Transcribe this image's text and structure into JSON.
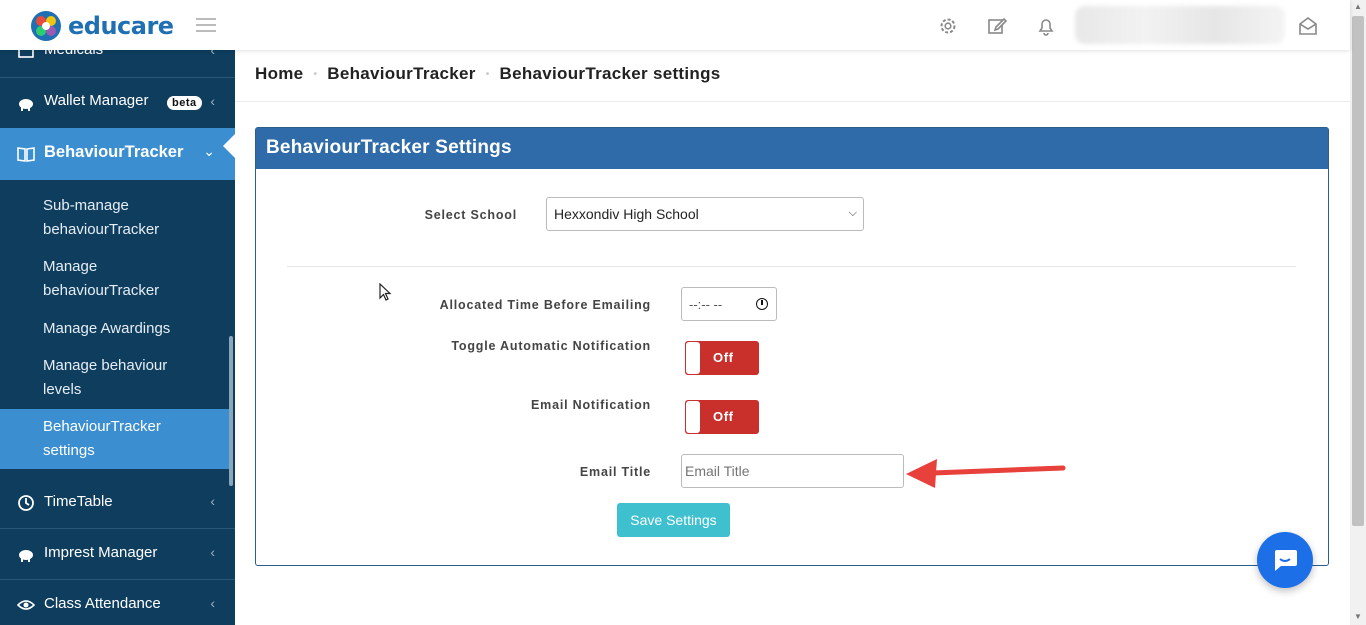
{
  "app": {
    "logo_text": "educare"
  },
  "breadcrumb": {
    "items": [
      "Home",
      "BehaviourTracker",
      "BehaviourTracker settings"
    ],
    "separator": "•"
  },
  "sidebar": {
    "items": [
      {
        "label": "Medicals",
        "icon": "medical-icon"
      },
      {
        "label": "Wallet Manager",
        "badge": "beta",
        "icon": "piggy-bank-icon"
      },
      {
        "label": "BehaviourTracker",
        "icon": "book-icon",
        "active": true
      },
      {
        "label": "TimeTable",
        "icon": "clock-icon"
      },
      {
        "label": "Imprest Manager",
        "icon": "piggy-bank-icon"
      },
      {
        "label": "Class Attendance",
        "icon": "eye-icon"
      }
    ],
    "sub_items": [
      "Sub-manage behaviourTracker",
      "Manage behaviourTracker",
      "Manage Awardings",
      "Manage behaviour levels",
      "BehaviourTracker settings"
    ]
  },
  "panel": {
    "title": "BehaviourTracker Settings",
    "select_school": {
      "label": "Select School",
      "value": "Hexxondiv High School"
    },
    "allocated_time": {
      "label": "Allocated Time Before Emailing",
      "value": "--:-- --"
    },
    "auto_notification": {
      "label": "Toggle Automatic Notification",
      "state": "Off"
    },
    "email_notification": {
      "label": "Email Notification",
      "state": "Off"
    },
    "email_title": {
      "label": "Email Title",
      "placeholder": "Email Title"
    },
    "save_label": "Save Settings"
  },
  "colors": {
    "sidebar_bg": "#0f3d5e",
    "sidebar_active": "#3b8fd0",
    "panel_header": "#2f6ba8",
    "toggle_off": "#c9302c",
    "save_button": "#3ec0cf",
    "annotation_arrow": "#e8403a",
    "chat_button": "#1d6fe8"
  }
}
